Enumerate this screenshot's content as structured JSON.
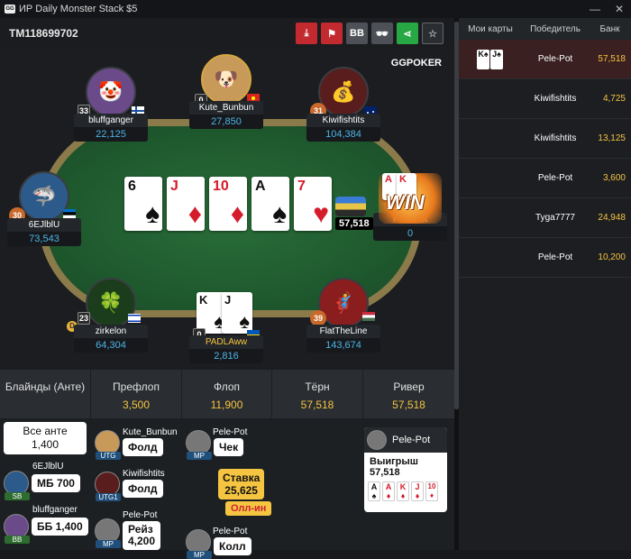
{
  "window": {
    "title": "ИР  Daily Monster Stack $5",
    "logo_text": "GG"
  },
  "hand": {
    "id": "TM118699702"
  },
  "toolbar": {
    "download_icon": "download-icon",
    "flag_icon": "flag-icon",
    "bb_label": "BB",
    "spy_icon": "incognito-icon",
    "share_icon": "share-icon",
    "star_icon": "star-icon"
  },
  "brand": "GGPOKER",
  "players": {
    "bluffganger": {
      "name": "bluffganger",
      "stack": "22,125",
      "level": "33"
    },
    "kute": {
      "name": "Kute_Bunbun",
      "stack": "27,850",
      "level": "0"
    },
    "kiwi": {
      "name": "Kiwifishtits",
      "stack": "104,384",
      "level": "31"
    },
    "six": {
      "name": "6EJlblU",
      "stack": "73,543",
      "level": "30"
    },
    "pele": {
      "name": "Pele-Pot",
      "stack": "0",
      "level": "57"
    },
    "zirkelon": {
      "name": "zirkelon",
      "stack": "64,304",
      "level": "23"
    },
    "padla": {
      "name": "PADLAww",
      "stack": "2,816",
      "level": "0"
    },
    "flat": {
      "name": "FlatTheLine",
      "stack": "143,674",
      "level": "39"
    }
  },
  "board": [
    {
      "rank": "6",
      "suit": "♠",
      "color": "blk"
    },
    {
      "rank": "J",
      "suit": "♦",
      "color": "redc"
    },
    {
      "rank": "10",
      "suit": "♦",
      "color": "redc"
    },
    {
      "rank": "A",
      "suit": "♠",
      "color": "blk"
    },
    {
      "rank": "7",
      "suit": "♥",
      "color": "redc"
    }
  ],
  "pot": "57,518",
  "win_label": "WIN",
  "hole_cards": [
    {
      "rank": "K",
      "suit": "♠"
    },
    {
      "rank": "J",
      "suit": "♠"
    }
  ],
  "winner_cards": [
    {
      "rank": "A",
      "suit": "♦"
    },
    {
      "rank": "K",
      "suit": "♦"
    }
  ],
  "streets": [
    {
      "label": "Блайнды (Анте)",
      "value": ""
    },
    {
      "label": "Префлоп",
      "value": "3,500"
    },
    {
      "label": "Флоп",
      "value": "11,900"
    },
    {
      "label": "Тёрн",
      "value": "57,518"
    },
    {
      "label": "Ривер",
      "value": "57,518"
    }
  ],
  "actions": {
    "ante": "Все анте\n1,400",
    "sb_name": "6EJlblU",
    "sb_badge": "SB",
    "sb_act": "МБ 700",
    "bb_name": "bluffganger",
    "bb_badge": "BB",
    "bb_act": "ББ 1,400",
    "utg_name": "Kute_Bunbun",
    "utg_badge": "UTG",
    "utg_act": "Фолд",
    "utg1_name": "Kiwifishtits",
    "utg1_badge": "UTG1",
    "utg1_act": "Фолд",
    "mp_name": "Pele-Pot",
    "mp_badge": "MP",
    "mp_act": "Рейз\n4,200",
    "flop1_name": "Pele-Pot",
    "flop1_badge": "MP",
    "flop1_act": "Чек",
    "flop_bet": "Ставка\n25,625",
    "flop_allin": "Олл-ин",
    "flop2_name": "Pele-Pot",
    "flop2_badge": "MP",
    "flop2_act": "Колл",
    "river_name": "Pele-Pot",
    "river_win": "Выигрыш 57,518",
    "river_cards": [
      {
        "rank": "A",
        "suit": "♠",
        "c": "#111"
      },
      {
        "rank": "A",
        "suit": "♦",
        "c": "#d41c2a"
      },
      {
        "rank": "K",
        "suit": "♦",
        "c": "#d41c2a"
      },
      {
        "rank": "J",
        "suit": "♦",
        "c": "#d41c2a"
      },
      {
        "rank": "10",
        "suit": "♦",
        "c": "#d41c2a"
      }
    ]
  },
  "sidebar": {
    "headers": [
      "Мои карты",
      "Победитель",
      "Банк"
    ],
    "rows": [
      {
        "cards": [
          "K♠",
          "J♠"
        ],
        "winner": "Pele-Pot",
        "pot": "57,518"
      },
      {
        "cards": [],
        "winner": "Kiwifishtits",
        "pot": "4,725"
      },
      {
        "cards": [],
        "winner": "Kiwifishtits",
        "pot": "13,125"
      },
      {
        "cards": [],
        "winner": "Pele-Pot",
        "pot": "3,600"
      },
      {
        "cards": [],
        "winner": "Tyga7777",
        "pot": "24,948"
      },
      {
        "cards": [],
        "winner": "Pele-Pot",
        "pot": "10,200"
      }
    ]
  }
}
